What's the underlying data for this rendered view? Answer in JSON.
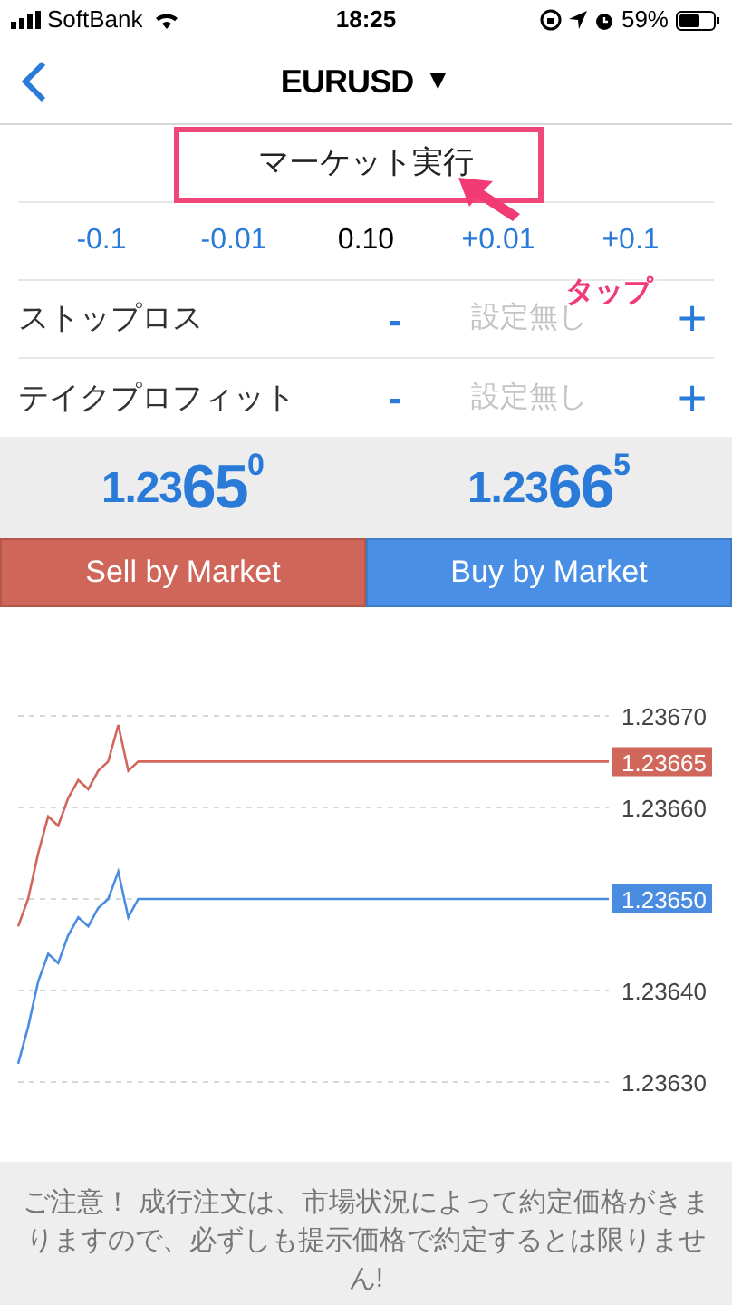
{
  "status_bar": {
    "carrier": "SoftBank",
    "time": "18:25",
    "battery": "59%"
  },
  "nav": {
    "title": "EURUSD",
    "dropdown": "▼"
  },
  "order_type": "マーケット実行",
  "volume": {
    "steps": [
      "-0.1",
      "-0.01"
    ],
    "value": "0.10",
    "steps_up": [
      "+0.01",
      "+0.1"
    ]
  },
  "levels": [
    {
      "label": "ストップロス",
      "minus": "-",
      "placeholder": "設定無し",
      "plus": "+"
    },
    {
      "label": "テイクプロフィット",
      "minus": "-",
      "placeholder": "設定無し",
      "plus": "+"
    }
  ],
  "prices": [
    {
      "prefix": "1.23",
      "big": "65",
      "sup": "0"
    },
    {
      "prefix": "1.23",
      "big": "66",
      "sup": "5"
    }
  ],
  "buttons": [
    {
      "label": "Sell by Market",
      "kind": "sell"
    },
    {
      "label": "Buy by Market",
      "kind": "buy"
    }
  ],
  "chart": {
    "chart_data": {
      "type": "line",
      "grid": true,
      "ylim": [
        1.2363,
        1.2367
      ],
      "yticks": [
        {
          "value": 1.2367,
          "label": "1.23670"
        },
        {
          "value": 1.2366,
          "label": "1.23660"
        },
        {
          "value": 1.2364,
          "label": "1.23640"
        },
        {
          "value": 1.2363,
          "label": "1.23630"
        }
      ],
      "series": [
        {
          "color": "#d0675a",
          "values": [
            1.23647,
            1.2365,
            1.23655,
            1.23659,
            1.23658,
            1.23661,
            1.23663,
            1.23662,
            1.23664,
            1.23665,
            1.23669,
            1.23664,
            1.23665,
            1.23665,
            1.23665,
            1.23665,
            1.23665,
            1.23665,
            1.23665,
            1.23665,
            1.23665,
            1.23665,
            1.23665,
            1.23665,
            1.23665,
            1.23665,
            1.23665,
            1.23665,
            1.23665,
            1.23665,
            1.23665,
            1.23665,
            1.23665,
            1.23665,
            1.23665,
            1.23665,
            1.23665,
            1.23665,
            1.23665,
            1.23665,
            1.23665,
            1.23665,
            1.23665,
            1.23665,
            1.23665,
            1.23665,
            1.23665,
            1.23665,
            1.23665,
            1.23665,
            1.23665,
            1.23665,
            1.23665,
            1.23665,
            1.23665,
            1.23665,
            1.23665,
            1.23665,
            1.23665,
            1.23665
          ]
        },
        {
          "color": "#4a8de0",
          "values": [
            1.23632,
            1.23636,
            1.23641,
            1.23644,
            1.23643,
            1.23646,
            1.23648,
            1.23647,
            1.23649,
            1.2365,
            1.23653,
            1.23648,
            1.2365,
            1.2365,
            1.2365,
            1.2365,
            1.2365,
            1.2365,
            1.2365,
            1.2365,
            1.2365,
            1.2365,
            1.2365,
            1.2365,
            1.2365,
            1.2365,
            1.2365,
            1.2365,
            1.2365,
            1.2365,
            1.2365,
            1.2365,
            1.2365,
            1.2365,
            1.2365,
            1.2365,
            1.2365,
            1.2365,
            1.2365,
            1.2365,
            1.2365,
            1.2365,
            1.2365,
            1.2365,
            1.2365,
            1.2365,
            1.2365,
            1.2365,
            1.2365,
            1.2365,
            1.2365,
            1.2365,
            1.2365,
            1.2365,
            1.2365,
            1.2365,
            1.2365,
            1.2365,
            1.2365,
            1.2365
          ]
        }
      ]
    },
    "price_tags": [
      {
        "text": "1.23665",
        "color": "#d0675a"
      },
      {
        "text": "1.23650",
        "color": "#4a8de0"
      }
    ]
  },
  "notice": "ご注意！ 成行注文は、市場状況によって約定価格がきまりますので、必ずしも提示価格で約定するとは限りません!",
  "annotation": {
    "label": "タップ"
  }
}
